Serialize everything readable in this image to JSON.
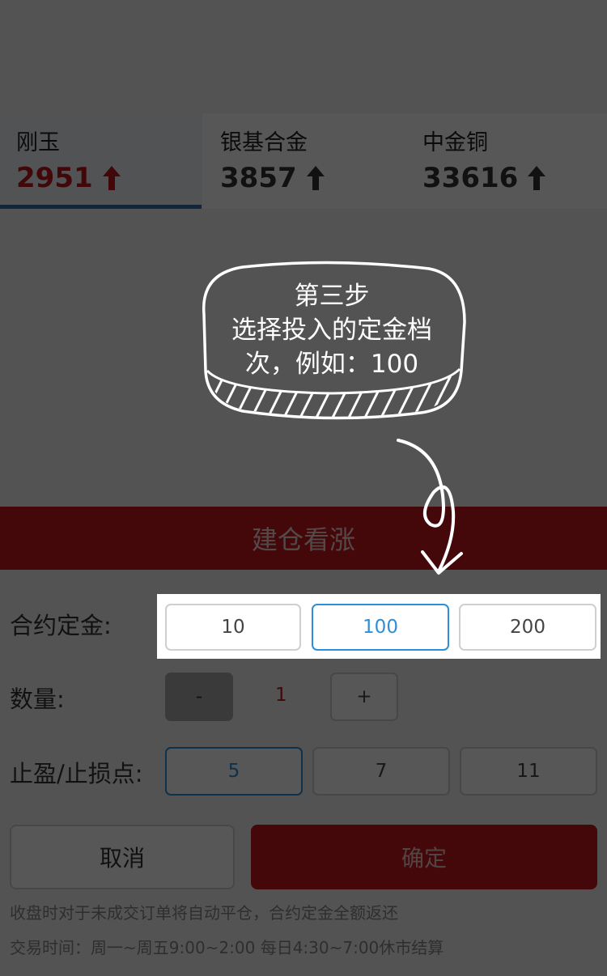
{
  "tabs": [
    {
      "name": "刚玉",
      "price": "2951",
      "active": true
    },
    {
      "name": "银基合金",
      "price": "3857",
      "active": false
    },
    {
      "name": "中金铜",
      "price": "33616",
      "active": false
    }
  ],
  "action": {
    "title": "建仓看涨"
  },
  "form": {
    "deposit_label": "合约定金:",
    "deposit_options": [
      "10",
      "100",
      "200"
    ],
    "deposit_selected": "100",
    "quantity_label": "数量:",
    "quantity_minus": "-",
    "quantity_value": "1",
    "quantity_plus": "+",
    "stop_label": "止盈/止损点:",
    "stop_options": [
      "5",
      "7",
      "11"
    ],
    "stop_selected": "5"
  },
  "buttons": {
    "cancel": "取消",
    "confirm": "确定"
  },
  "notes": {
    "line1": "收盘时对于未成交订单将自动平仓，合约定金全额返还",
    "line2": "交易时间：周一~周五9:00~2:00 每日4:30~7:00休市结算"
  },
  "tutorial": {
    "line1": "第三步",
    "line2": "选择投入的定金档",
    "line3": "次，例如：100"
  },
  "colors": {
    "accent_red": "#c8171e",
    "accent_blue": "#2d8fd8",
    "tab_underline": "#2f6fb5"
  }
}
